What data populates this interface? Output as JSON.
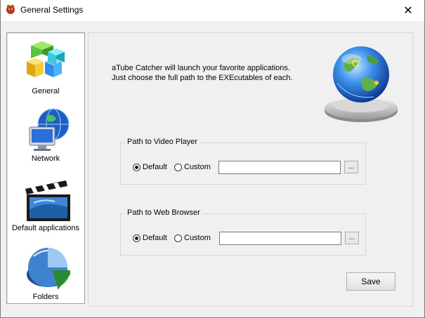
{
  "window": {
    "title": "General Settings",
    "close_glyph": "✕"
  },
  "sidebar": {
    "items": [
      {
        "label": "General",
        "icon": "cubes-icon"
      },
      {
        "label": "Network",
        "icon": "network-globe-icon"
      },
      {
        "label": "Default applications",
        "icon": "clapperboard-icon"
      },
      {
        "label": "Folders",
        "icon": "pie-chart-icon"
      }
    ]
  },
  "main": {
    "intro": "aTube Catcher will launch your favorite applications. Just choose the full path to the EXEcutables of each.",
    "video_player": {
      "title": "Path to Video Player",
      "default_label": "Default",
      "custom_label": "Custom",
      "path_value": "",
      "browse_label": "..."
    },
    "web_browser": {
      "title": "Path to Web Browser",
      "default_label": "Default",
      "custom_label": "Custom",
      "path_value": "",
      "browse_label": "..."
    },
    "save_label": "Save"
  }
}
